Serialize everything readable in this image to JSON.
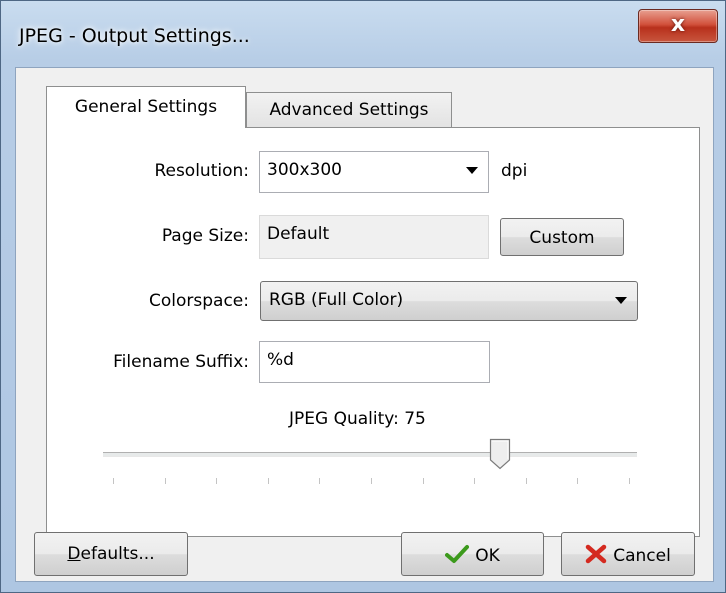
{
  "window": {
    "title": "JPEG - Output Settings...",
    "close_symbol": "x"
  },
  "tabs": [
    {
      "label": "General Settings",
      "selected": true
    },
    {
      "label": "Advanced Settings",
      "selected": false
    }
  ],
  "form": {
    "resolution": {
      "label": "Resolution:",
      "value": "300x300",
      "unit": "dpi"
    },
    "page_size": {
      "label": "Page Size:",
      "value": "Default",
      "button": "Custom"
    },
    "colorspace": {
      "label": "Colorspace:",
      "value": "RGB (Full Color)"
    },
    "filename_suffix": {
      "label": "Filename Suffix:",
      "value": "%d"
    },
    "quality": {
      "label": "JPEG Quality:",
      "value": "75",
      "fraction": 0.75,
      "ticks": 11
    }
  },
  "buttons": {
    "defaults_mnemonic": "D",
    "defaults_rest": "efaults...",
    "ok": "OK",
    "cancel": "Cancel"
  },
  "icons": {
    "ok": "check-icon",
    "cancel": "x-mark-icon"
  },
  "colors": {
    "check": "#3c9a1c",
    "cancel": "#d42a20",
    "close": "#c7452f"
  }
}
